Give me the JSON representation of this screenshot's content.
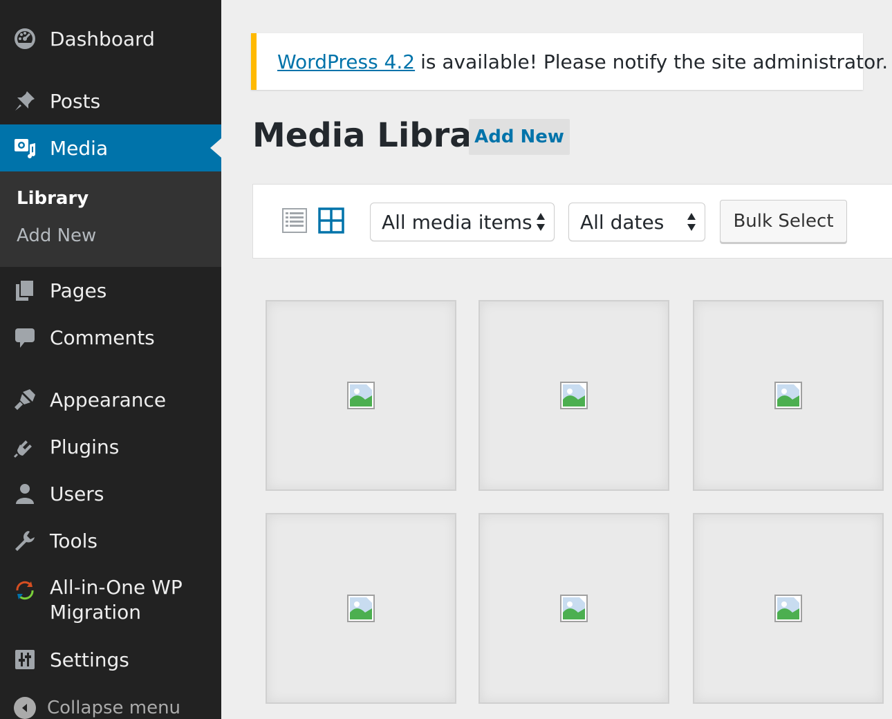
{
  "sidebar": {
    "items": [
      {
        "label": "Dashboard",
        "icon": "dashboard-icon"
      },
      {
        "label": "Posts",
        "icon": "pin-icon"
      },
      {
        "label": "Media",
        "icon": "media-icon"
      },
      {
        "label": "Pages",
        "icon": "pages-icon"
      },
      {
        "label": "Comments",
        "icon": "comment-icon"
      },
      {
        "label": "Appearance",
        "icon": "brush-icon"
      },
      {
        "label": "Plugins",
        "icon": "plug-icon"
      },
      {
        "label": "Users",
        "icon": "user-icon"
      },
      {
        "label": "Tools",
        "icon": "wrench-icon"
      },
      {
        "label": "All-in-One WP Migration",
        "icon": "migration-icon"
      },
      {
        "label": "Settings",
        "icon": "settings-icon"
      }
    ],
    "submenu": [
      {
        "label": "Library"
      },
      {
        "label": "Add New"
      }
    ],
    "collapse_label": "Collapse menu"
  },
  "notice": {
    "link_text": "WordPress 4.2",
    "message": "is available! Please notify the site administrator."
  },
  "page": {
    "title": "Media Library",
    "add_new_label": "Add New"
  },
  "toolbar": {
    "filter_type": "All media items",
    "filter_date": "All dates",
    "bulk_select_label": "Bulk Select"
  },
  "media_items": 6,
  "colors": {
    "sidebar_bg": "#222222",
    "active_bg": "#0073aa",
    "notice_accent": "#ffb900",
    "link": "#0073aa"
  }
}
